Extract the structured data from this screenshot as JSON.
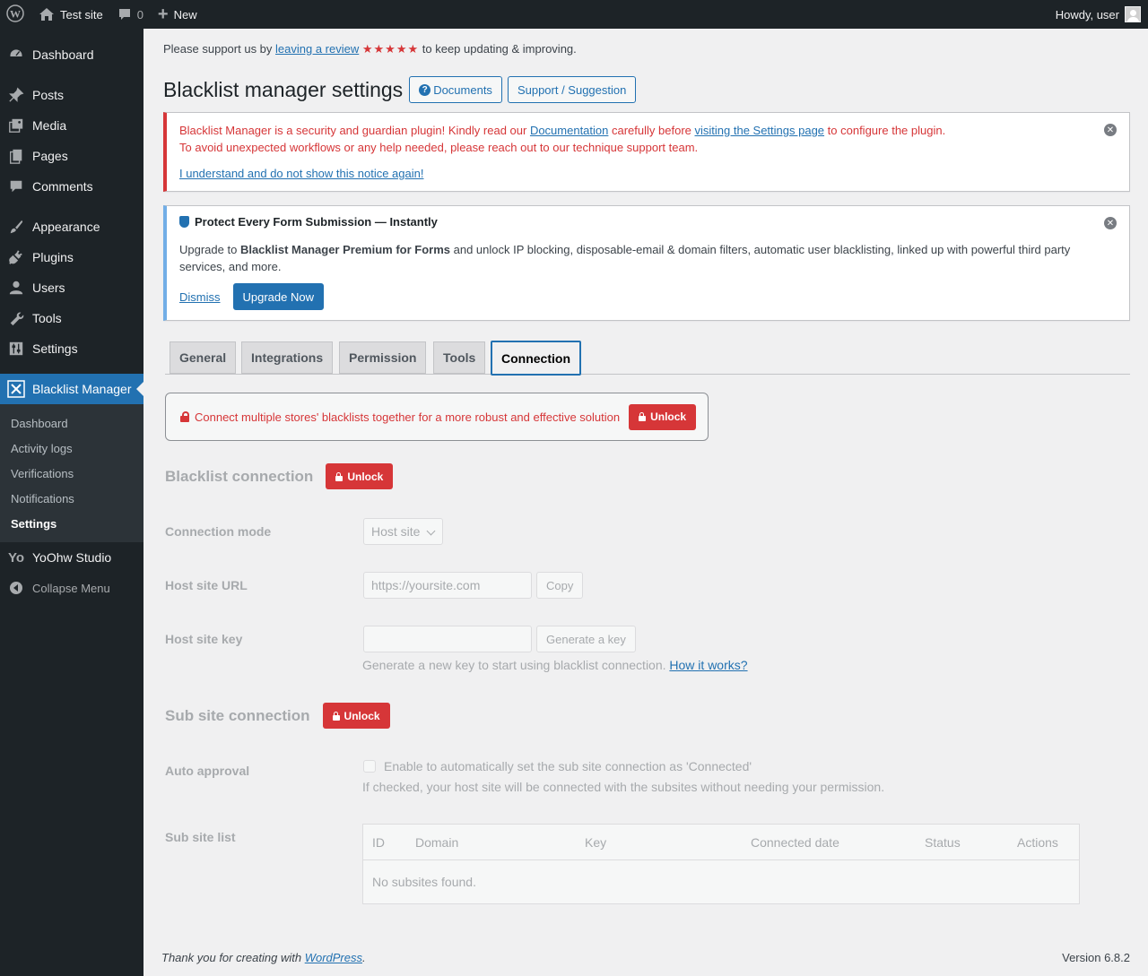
{
  "adminbar": {
    "site_name": "Test site",
    "comments_count": "0",
    "new_label": "New",
    "howdy": "Howdy, user"
  },
  "menu": {
    "items": [
      {
        "label": "Dashboard",
        "icon": "dashboard-icon"
      },
      {
        "label": "Posts",
        "icon": "pin-icon"
      },
      {
        "label": "Media",
        "icon": "media-icon"
      },
      {
        "label": "Pages",
        "icon": "pages-icon"
      },
      {
        "label": "Comments",
        "icon": "comments-icon"
      },
      {
        "label": "Appearance",
        "icon": "brush-icon"
      },
      {
        "label": "Plugins",
        "icon": "plugin-icon"
      },
      {
        "label": "Users",
        "icon": "users-icon"
      },
      {
        "label": "Tools",
        "icon": "wrench-icon"
      },
      {
        "label": "Settings",
        "icon": "settings-icon"
      },
      {
        "label": "Blacklist Manager",
        "icon": "blacklist-icon"
      },
      {
        "label": "YoOhw Studio",
        "icon": "yo-icon"
      }
    ],
    "submenu": [
      "Dashboard",
      "Activity logs",
      "Verifications",
      "Notifications",
      "Settings"
    ],
    "collapse": "Collapse Menu"
  },
  "support": {
    "prefix": "Please support us by ",
    "link": "leaving a review",
    "stars": "★★★★★",
    "suffix": " to keep updating & improving."
  },
  "page": {
    "title": "Blacklist manager settings",
    "documents_button": "Documents",
    "support_button": "Support / Suggestion"
  },
  "error_notice": {
    "line1_a": "Blacklist Manager is a security and guardian plugin! Kindly read our ",
    "line1_link1": "Documentation",
    "line1_b": " carefully before ",
    "line1_link2": "visiting the Settings page",
    "line1_c": " to configure the plugin.",
    "line2": "To avoid unexpected workflows or any help needed, please reach out to our technique support team.",
    "ack_link": "I understand and do not show this notice again!"
  },
  "info_notice": {
    "title": "Protect Every Form Submission — Instantly",
    "body_a": "Upgrade to ",
    "body_bold": "Blacklist Manager Premium for Forms",
    "body_b": " and unlock IP blocking, disposable-email & domain filters, automatic user blacklisting, linked up with powerful third party services, and more.",
    "dismiss": "Dismiss",
    "upgrade": "Upgrade Now"
  },
  "tabs": [
    "General",
    "Integrations",
    "Permission",
    "Tools",
    "Connection"
  ],
  "active_tab": "Connection",
  "lock_box": {
    "text": "Connect multiple stores' blacklists together for a more robust and effective solution",
    "button": "Unlock"
  },
  "blacklist_connection": {
    "title": "Blacklist connection",
    "unlock": "Unlock",
    "connection_mode_label": "Connection mode",
    "connection_mode_value": "Host site",
    "host_url_label": "Host site URL",
    "host_url_placeholder": "https://yoursite.com",
    "copy_button": "Copy",
    "host_key_label": "Host site key",
    "generate_button": "Generate a key",
    "key_desc": "Generate a new key to start using blacklist connection. ",
    "how_link": "How it works?"
  },
  "sub_site_connection": {
    "title": "Sub site connection",
    "unlock": "Unlock",
    "auto_label": "Auto approval",
    "auto_checkbox_label": "Enable to automatically set the sub site connection as 'Connected'",
    "auto_desc": "If checked, your host site will be connected with the subsites without needing your permission.",
    "list_label": "Sub site list",
    "columns": [
      "ID",
      "Domain",
      "Key",
      "Connected date",
      "Status",
      "Actions"
    ],
    "empty": "No subsites found."
  },
  "footer": {
    "prefix": "Thank you for creating with ",
    "link": "WordPress",
    "suffix": ".",
    "version": "Version 6.8.2"
  }
}
